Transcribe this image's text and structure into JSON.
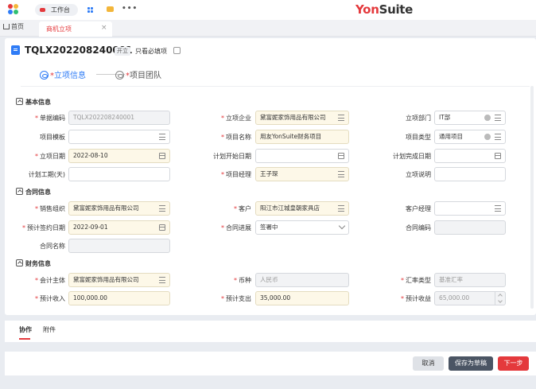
{
  "topbar": {
    "workbench_label": "工作台",
    "brand_red": "YonSuite",
    "icons": [
      "app-logo-icon",
      "grid-icon",
      "chat-icon",
      "more-icon"
    ],
    "accent": "#e4393c"
  },
  "tabs": {
    "home_label": "首页",
    "active_label": "商机立项",
    "close_glyph": "×"
  },
  "header": {
    "title": "TQLX202208240001",
    "status": "开立",
    "required_only_label": "只看必填项",
    "required_only_checked": false
  },
  "steps": [
    {
      "label": "立项信息",
      "required": true,
      "active": true
    },
    {
      "label": "项目团队",
      "required": true,
      "active": false
    }
  ],
  "sections": {
    "basic": "基本信息",
    "contract": "合同信息",
    "finance": "财务信息"
  },
  "fields": {
    "doc_code": {
      "label": "单据编码",
      "value": "TQLX202208240001",
      "required": true
    },
    "company": {
      "label": "立项企业",
      "value": "黛富妮家饰用品有限公司",
      "required": true
    },
    "dept": {
      "label": "立项部门",
      "value": "IT部",
      "required": false
    },
    "template": {
      "label": "项目模板",
      "value": "",
      "required": false
    },
    "proj_name": {
      "label": "项目名称",
      "value": "用友YonSuite财务项目",
      "required": true
    },
    "proj_type": {
      "label": "项目类型",
      "value": "通用项目",
      "required": false
    },
    "setup_date": {
      "label": "立项日期",
      "value": "2022-08-10",
      "required": true
    },
    "plan_start": {
      "label": "计划开始日期",
      "value": "",
      "required": false
    },
    "plan_end": {
      "label": "计划完成日期",
      "value": "",
      "required": false
    },
    "plan_days": {
      "label": "计划工期(天)",
      "value": "",
      "required": false
    },
    "manager": {
      "label": "项目经理",
      "value": "王子琛",
      "required": true
    },
    "desc": {
      "label": "立项说明",
      "value": "",
      "required": false
    },
    "sales_org": {
      "label": "销售组织",
      "value": "黛富妮家饰用品有限公司",
      "required": true
    },
    "customer": {
      "label": "客户",
      "value": "阳江市江城皇朝家具店",
      "required": true
    },
    "cust_manager": {
      "label": "客户经理",
      "value": "",
      "required": false
    },
    "sign_date": {
      "label": "预计签约日期",
      "value": "2022-09-01",
      "required": true
    },
    "contract_progress": {
      "label": "合同进展",
      "value": "签署中",
      "required": true
    },
    "contract_code": {
      "label": "合同编码",
      "value": "",
      "required": false
    },
    "contract_name": {
      "label": "合同名称",
      "value": "",
      "required": false
    },
    "acct_entity": {
      "label": "会计主体",
      "value": "黛富妮家饰用品有限公司",
      "required": true
    },
    "currency": {
      "label": "币种",
      "value": "人民币",
      "required": true
    },
    "rate_type": {
      "label": "汇率类型",
      "value": "基准汇率",
      "required": true
    },
    "exp_income": {
      "label": "预计收入",
      "value": "100,000.00",
      "required": true
    },
    "exp_expense": {
      "label": "预计支出",
      "value": "35,000.00",
      "required": true
    },
    "exp_profit": {
      "label": "预计收益",
      "value": "65,000.00",
      "required": true
    }
  },
  "subtabs": [
    "协作",
    "附件"
  ],
  "buttons": {
    "cancel": "取消",
    "save_draft": "保存为草稿",
    "next": "下一步"
  }
}
